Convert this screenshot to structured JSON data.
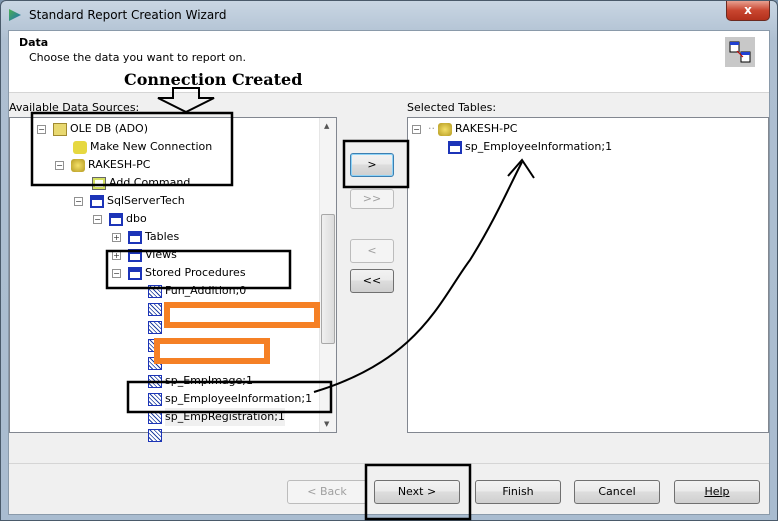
{
  "window": {
    "title": "Standard Report Creation Wizard",
    "close": "x"
  },
  "header": {
    "title": "Data",
    "subtitle": "Choose the data you want to report on."
  },
  "annotation": {
    "callout": "Connection Created"
  },
  "available": {
    "label": "Available Data Sources:",
    "tree": [
      "OLE DB (ADO)",
      "Make New Connection",
      "RAKESH-PC",
      "Add Command",
      "SqlServerTech",
      "dbo",
      "Tables",
      "Views",
      "Stored Procedures",
      "Fun_Addition;0",
      "sp_EmpImage;1",
      "sp_EmployeeInformation;1",
      "sp_EmpRegistration;1"
    ]
  },
  "selected": {
    "label": "Selected Tables:",
    "tree": [
      "RAKESH-PC",
      "sp_EmployeeInformation;1"
    ]
  },
  "transfer": {
    "add": ">",
    "add_all": ">>",
    "remove": "<",
    "remove_all": "<<"
  },
  "footer": {
    "back": "< Back",
    "next": "Next >",
    "finish": "Finish",
    "cancel": "Cancel",
    "help": "Help"
  }
}
